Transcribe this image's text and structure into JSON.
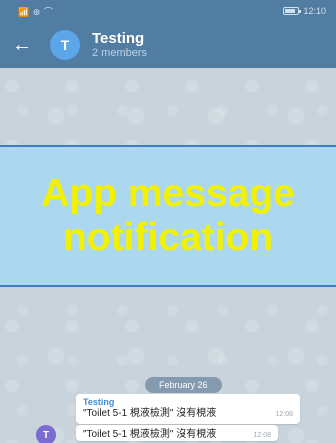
{
  "status_bar": {
    "left_text": "📶 ⊛ ⌒",
    "time": "12:10"
  },
  "header": {
    "back_icon": "←",
    "avatar_letter": "T",
    "title": "Testing",
    "subtitle": "2 members"
  },
  "overlay": {
    "line1": "App message",
    "line2": "notification"
  },
  "chat": {
    "date": "February 26",
    "messages": [
      {
        "sender": "Testing",
        "text": "\"Toilet 5-1 梘液檢測\" 沒有梘液",
        "time": "12:08"
      },
      {
        "sender_avatar": "T",
        "text": "\"Toilet 5-1 梘液檢測\" 沒有梘液",
        "time": "12:08"
      }
    ]
  },
  "colors": {
    "header": "#527da3",
    "overlay_bg": "#a8d8f0",
    "overlay_text": "#f2f200",
    "avatar": "#5ca5e8"
  }
}
